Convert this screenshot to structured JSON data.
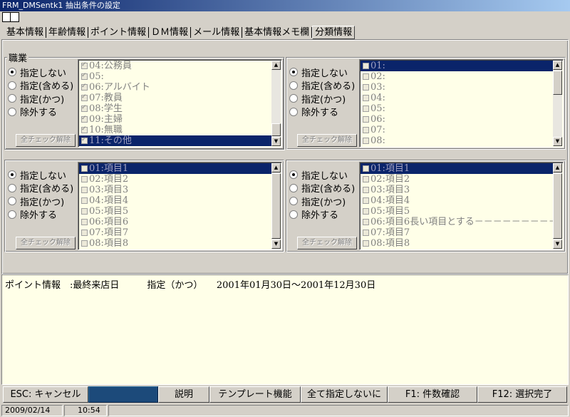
{
  "window": {
    "title": "FRM_DMSentk1 抽出条件の設定"
  },
  "tabs": [
    {
      "label": "基本情報"
    },
    {
      "label": "年齢情報"
    },
    {
      "label": "ポイント情報"
    },
    {
      "label": "ＤＭ情報"
    },
    {
      "label": "メール情報"
    },
    {
      "label": "基本情報メモ欄"
    },
    {
      "label": "分類情報",
      "active": true
    }
  ],
  "group_caption": "職業",
  "radio_options": [
    "指定しない",
    "指定(含める)",
    "指定(かつ)",
    "除外する"
  ],
  "clear_button_label": "全チェック解除",
  "panels": [
    {
      "selected_radio": 0,
      "items": [
        {
          "text": "04:公務員",
          "checked": true
        },
        {
          "text": "05:",
          "checked": true
        },
        {
          "text": "06:アルバイト",
          "checked": true
        },
        {
          "text": "07:教員",
          "checked": true
        },
        {
          "text": "08:学生",
          "checked": true
        },
        {
          "text": "09:主婦",
          "checked": true
        },
        {
          "text": "10:無職",
          "checked": true
        },
        {
          "text": "11:その他",
          "checked": true,
          "selected": true
        }
      ]
    },
    {
      "selected_radio": 0,
      "items": [
        {
          "text": "01:",
          "checked": false,
          "selected": true
        },
        {
          "text": "02:",
          "checked": false
        },
        {
          "text": "03:",
          "checked": false
        },
        {
          "text": "04:",
          "checked": false
        },
        {
          "text": "05:",
          "checked": false
        },
        {
          "text": "06:",
          "checked": false
        },
        {
          "text": "07:",
          "checked": false
        },
        {
          "text": "08:",
          "checked": false
        }
      ]
    },
    {
      "selected_radio": 0,
      "items": [
        {
          "text": "01:項目1",
          "checked": false,
          "selected": true
        },
        {
          "text": "02:項目2",
          "checked": false
        },
        {
          "text": "03:項目3",
          "checked": false
        },
        {
          "text": "04:項目4",
          "checked": false
        },
        {
          "text": "05:項目5",
          "checked": false
        },
        {
          "text": "06:項目6",
          "checked": false
        },
        {
          "text": "07:項目7",
          "checked": false
        },
        {
          "text": "08:項目8",
          "checked": false
        }
      ]
    },
    {
      "selected_radio": 0,
      "items": [
        {
          "text": "01:項目1",
          "checked": false,
          "selected": true
        },
        {
          "text": "02:項目2",
          "checked": false
        },
        {
          "text": "03:項目3",
          "checked": false
        },
        {
          "text": "04:項目4",
          "checked": false
        },
        {
          "text": "05:項目5",
          "checked": false
        },
        {
          "text": "06:項目6長い項目とする－－－－－－－－－",
          "checked": false
        },
        {
          "text": "07:項目7",
          "checked": false
        },
        {
          "text": "08:項目8",
          "checked": false
        }
      ]
    }
  ],
  "summary": {
    "line": "ポイント情報　:最終来店日　　　指定（かつ）　　2001年01月30日～2001年12月30日"
  },
  "function_keys": {
    "esc": "ESC: キャンセル",
    "blank": "",
    "help": "説明",
    "template": "テンプレート機能",
    "all_none": "全て指定しないに",
    "f1": "F1: 件数確認",
    "f12": "F12: 選択完了"
  },
  "status": {
    "date": "2009/02/14",
    "time": "10:54"
  }
}
